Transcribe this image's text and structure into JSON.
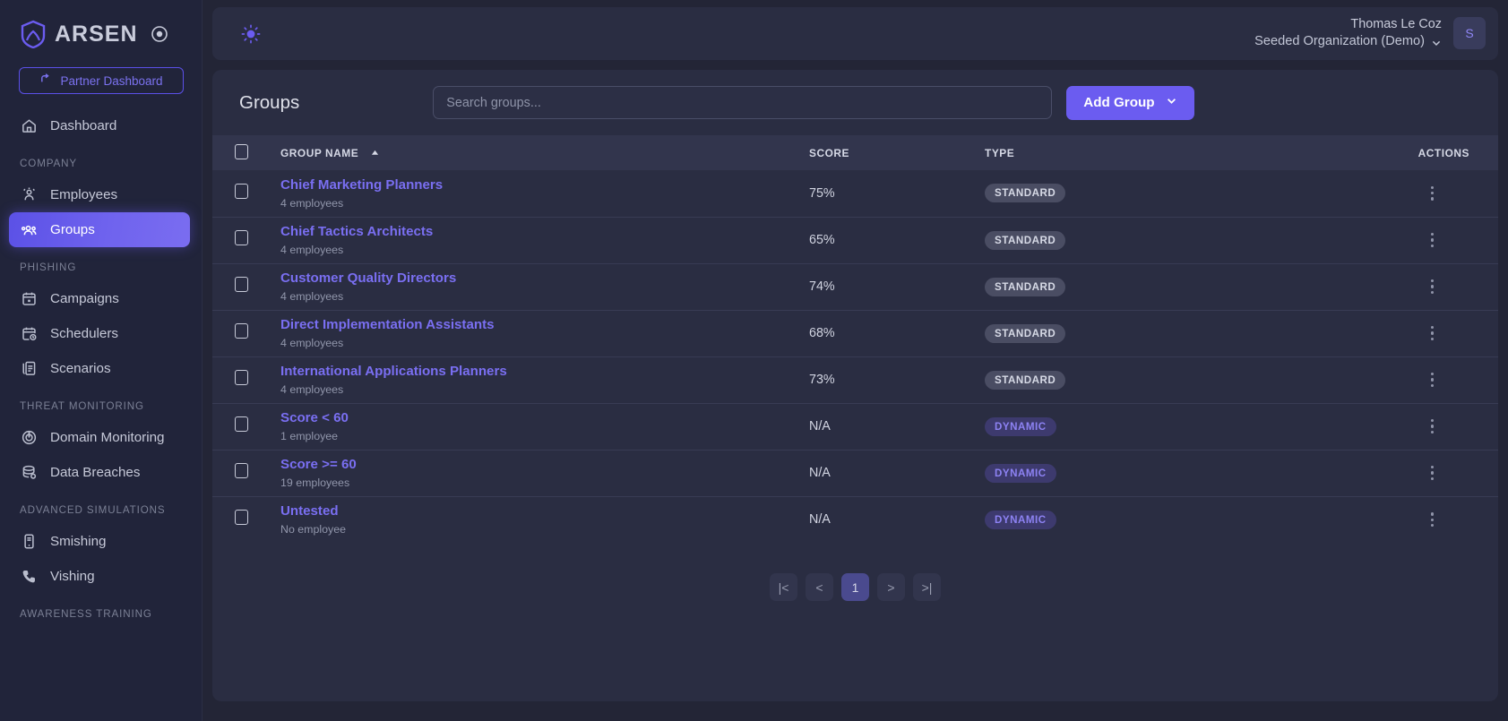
{
  "brand": {
    "name": "ARSEN",
    "logo_icon": "shield-logo-icon",
    "badge_icon": "target-dot-icon"
  },
  "sidebar": {
    "partner_button": {
      "label": "Partner Dashboard",
      "icon": "return-arrow-icon"
    },
    "groups": [
      {
        "section": null,
        "items": [
          {
            "label": "Dashboard",
            "icon": "home-icon",
            "active": false
          }
        ]
      },
      {
        "section": "COMPANY",
        "items": [
          {
            "label": "Employees",
            "icon": "employees-icon",
            "active": false
          },
          {
            "label": "Groups",
            "icon": "groups-icon",
            "active": true
          }
        ]
      },
      {
        "section": "PHISHING",
        "items": [
          {
            "label": "Campaigns",
            "icon": "calendar-icon",
            "active": false
          },
          {
            "label": "Schedulers",
            "icon": "calendar-clock-icon",
            "active": false
          },
          {
            "label": "Scenarios",
            "icon": "documents-icon",
            "active": false
          }
        ]
      },
      {
        "section": "THREAT MONITORING",
        "items": [
          {
            "label": "Domain Monitoring",
            "icon": "radar-icon",
            "active": false
          },
          {
            "label": "Data Breaches",
            "icon": "database-search-icon",
            "active": false
          }
        ]
      },
      {
        "section": "ADVANCED SIMULATIONS",
        "items": [
          {
            "label": "Smishing",
            "icon": "mobile-phone-icon",
            "active": false
          },
          {
            "label": "Vishing",
            "icon": "phone-icon",
            "active": false
          }
        ]
      },
      {
        "section": "AWARENESS TRAINING",
        "items": []
      }
    ]
  },
  "topbar": {
    "theme_toggle_icon": "sun-icon",
    "user_name": "Thomas Le Coz",
    "organization": "Seeded Organization (Demo)",
    "org_chevron_icon": "chevron-down-icon",
    "avatar_initial": "S"
  },
  "page": {
    "title": "Groups",
    "search_placeholder": "Search groups...",
    "search_value": "",
    "add_button": {
      "label": "Add Group",
      "chevron_icon": "chevron-down-icon"
    }
  },
  "table": {
    "columns": [
      {
        "key": "checkbox",
        "label": ""
      },
      {
        "key": "name",
        "label": "GROUP NAME",
        "sort_icon": "sort-ascending-icon",
        "sorted": "asc"
      },
      {
        "key": "score",
        "label": "SCORE"
      },
      {
        "key": "type",
        "label": "TYPE"
      },
      {
        "key": "actions",
        "label": "ACTIONS"
      }
    ],
    "rows": [
      {
        "name": "Chief Marketing Planners",
        "employees": "4 employees",
        "score": "75%",
        "type": "STANDARD",
        "type_class": "standard",
        "selected": false
      },
      {
        "name": "Chief Tactics Architects",
        "employees": "4 employees",
        "score": "65%",
        "type": "STANDARD",
        "type_class": "standard",
        "selected": false
      },
      {
        "name": "Customer Quality Directors",
        "employees": "4 employees",
        "score": "74%",
        "type": "STANDARD",
        "type_class": "standard",
        "selected": false
      },
      {
        "name": "Direct Implementation Assistants",
        "employees": "4 employees",
        "score": "68%",
        "type": "STANDARD",
        "type_class": "standard",
        "selected": false
      },
      {
        "name": "International Applications Planners",
        "employees": "4 employees",
        "score": "73%",
        "type": "STANDARD",
        "type_class": "standard",
        "selected": false
      },
      {
        "name": "Score < 60",
        "employees": "1 employee",
        "score": "N/A",
        "type": "DYNAMIC",
        "type_class": "dynamic",
        "selected": false
      },
      {
        "name": "Score >= 60",
        "employees": "19 employees",
        "score": "N/A",
        "type": "DYNAMIC",
        "type_class": "dynamic",
        "selected": false
      },
      {
        "name": "Untested",
        "employees": "No employee",
        "score": "N/A",
        "type": "DYNAMIC",
        "type_class": "dynamic",
        "selected": false
      }
    ],
    "row_action_icon": "kebab-menu-icon"
  },
  "pagination": {
    "first": "|<",
    "prev": "<",
    "current": "1",
    "next": ">",
    "last": ">|"
  },
  "colors": {
    "accent": "#6b5cf0",
    "link": "#7a6ff2",
    "sidebar_bg": "#21243a",
    "panel_bg": "#2a2d42",
    "page_bg": "#232536",
    "badge_dynamic_bg": "#3d3a6e",
    "badge_standard_bg": "#4a4d63"
  }
}
